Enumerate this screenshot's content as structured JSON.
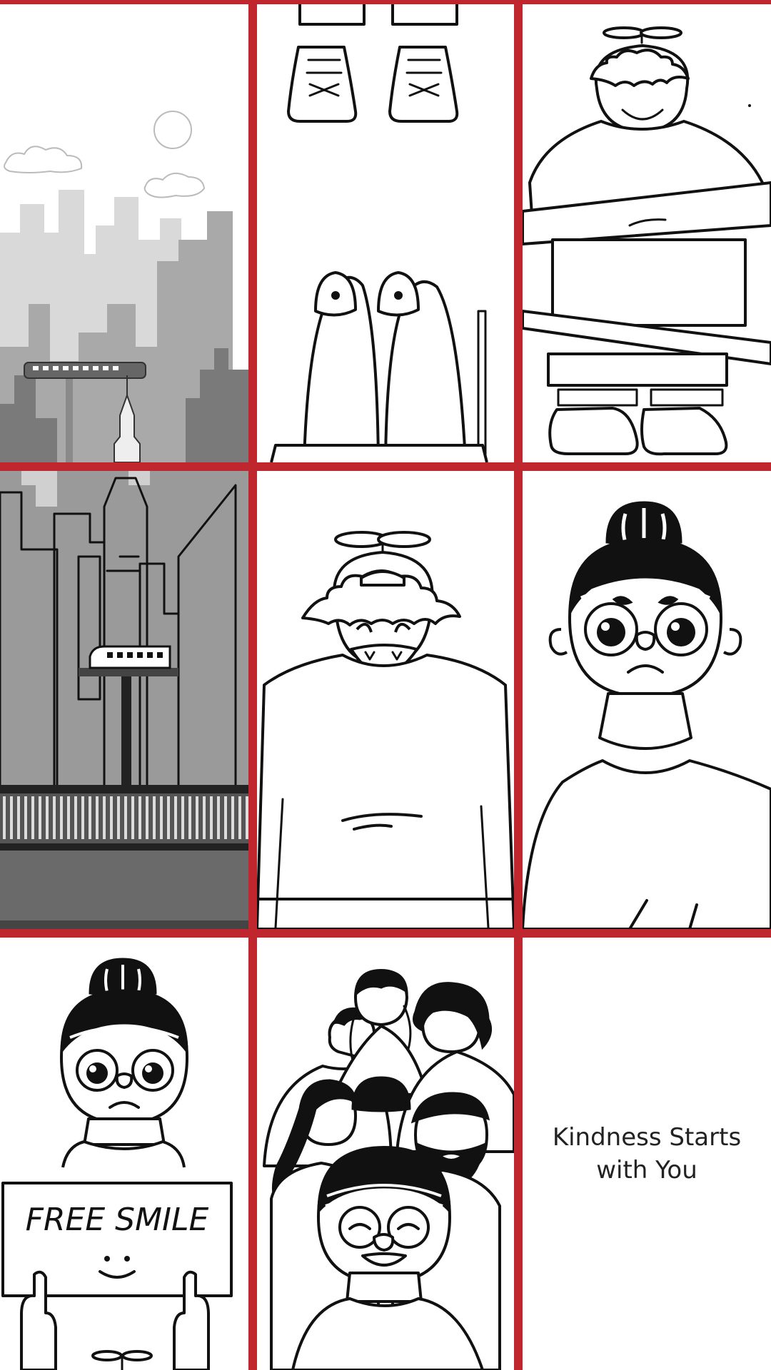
{
  "comic": {
    "panels": [
      {
        "scene": "city-skyline-monorail"
      },
      {
        "scene": "feet-close-up"
      },
      {
        "scene": "propeller-cap-kid-with-cut-strips"
      },
      {
        "scene": "city-bridge-monorail"
      },
      {
        "scene": "propeller-cap-kid-laughing"
      },
      {
        "scene": "glasses-kid-frowning"
      },
      {
        "scene": "glasses-kid-holding-sign"
      },
      {
        "scene": "group-of-friends-hugging"
      },
      {
        "scene": "closing-caption"
      }
    ],
    "sign_text": "FREE SMILE",
    "caption": "Kindness Starts\nwith You"
  },
  "colors": {
    "border": "#c0262d",
    "panel_bg": "#ffffff",
    "ink": "#111111",
    "city_light": "#d9d9d9",
    "city_mid": "#a9a9a9",
    "city_dark": "#7a7a7a"
  }
}
